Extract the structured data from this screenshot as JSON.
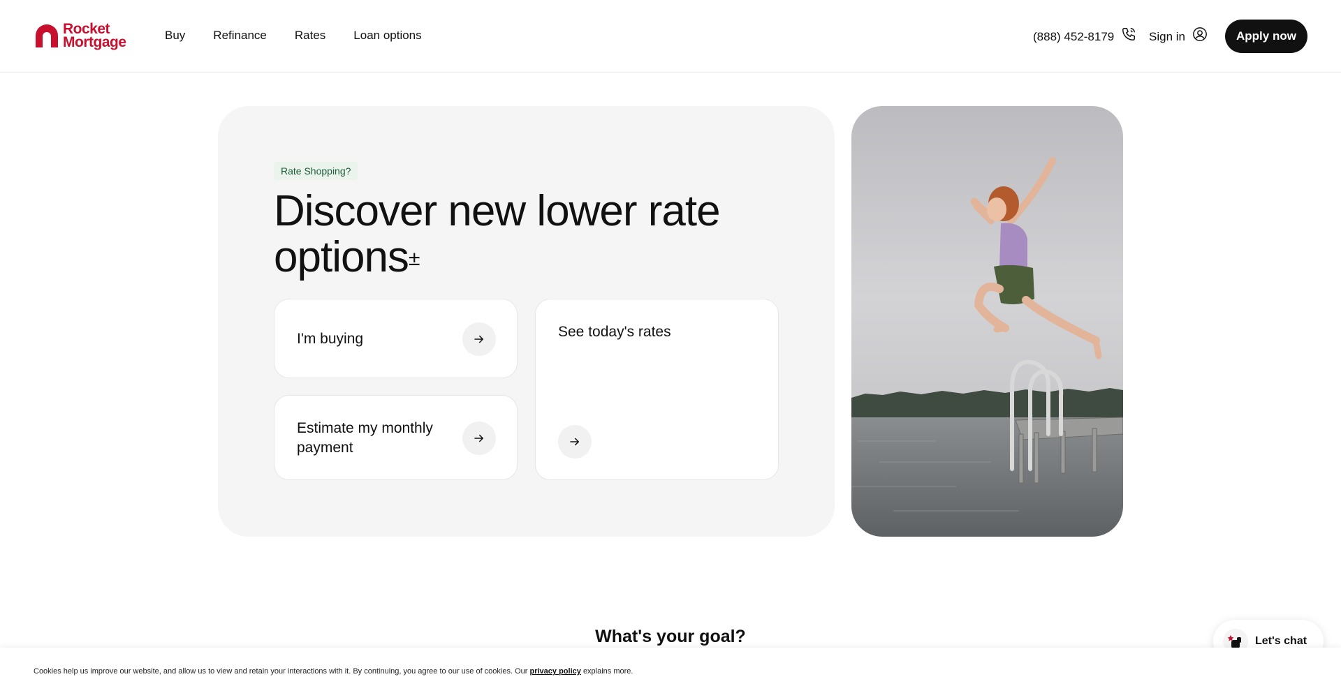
{
  "brand": {
    "logo_line1": "Rocket",
    "logo_line2": "Mortgage",
    "color": "#c8102e"
  },
  "nav": {
    "items": [
      "Buy",
      "Refinance",
      "Rates",
      "Loan options"
    ]
  },
  "header": {
    "phone": "(888) 452-8179",
    "phone_icon": "phone-icon",
    "signin": "Sign in",
    "signin_icon": "user-circle-icon",
    "apply": "Apply now"
  },
  "hero": {
    "badge": "Rate Shopping?",
    "headline": "Discover new lower rate options",
    "headline_sup": "±",
    "options": [
      {
        "label": "I'm buying",
        "icon": "arrow-right-icon"
      },
      {
        "label": "Estimate my monthly payment",
        "icon": "arrow-right-icon"
      },
      {
        "label": "See today's rates",
        "icon": "arrow-right-icon"
      }
    ]
  },
  "goal": {
    "title": "What's your goal?"
  },
  "chat": {
    "label": "Let's chat"
  },
  "cookie": {
    "text_before": "Cookies help us improve our website, and allow us to view and retain your interactions with it. By continuing, you agree to our use of cookies. Our",
    "link": "privacy policy",
    "text_after": "explains more."
  },
  "colors": {
    "dark": "#111111",
    "hero_bg": "#f5f5f5",
    "badge_bg": "#eaf3ec",
    "badge_text": "#1d5c36"
  }
}
